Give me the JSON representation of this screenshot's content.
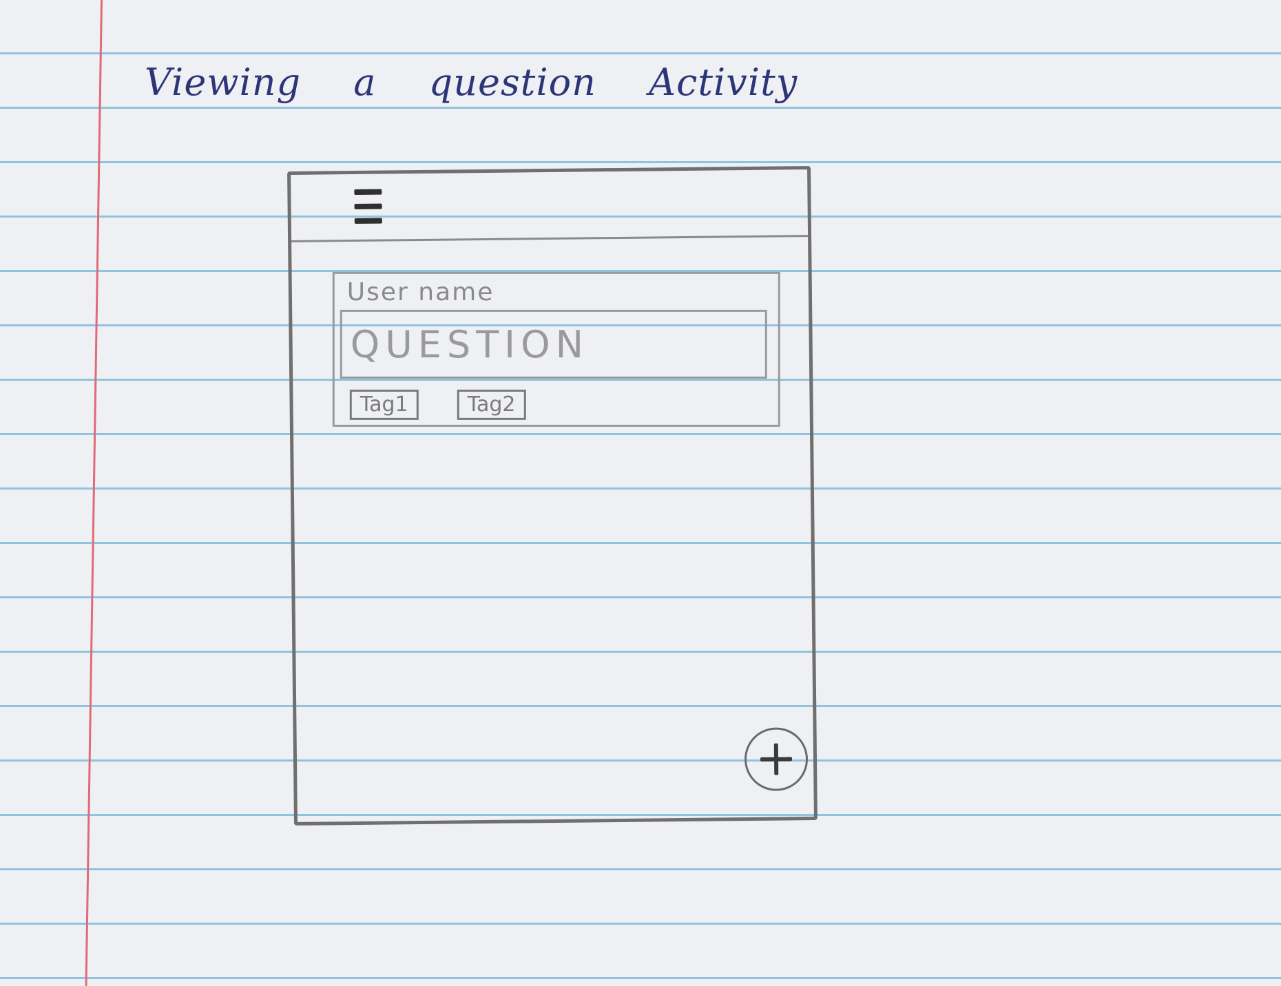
{
  "title": "Viewing a question Activity",
  "toolbar": {
    "menu_icon": "hamburger-menu-icon"
  },
  "question_card": {
    "user_name": "User name",
    "question": "QUESTION",
    "tags": [
      "Tag1",
      "Tag2"
    ]
  },
  "fab": {
    "icon": "plus-icon"
  },
  "colors": {
    "paper": "#eef0f4",
    "rule_line": "#8fc3de",
    "margin_line": "#e06a78",
    "ink": "#2c3577",
    "pencil": "#8a8a8a"
  }
}
